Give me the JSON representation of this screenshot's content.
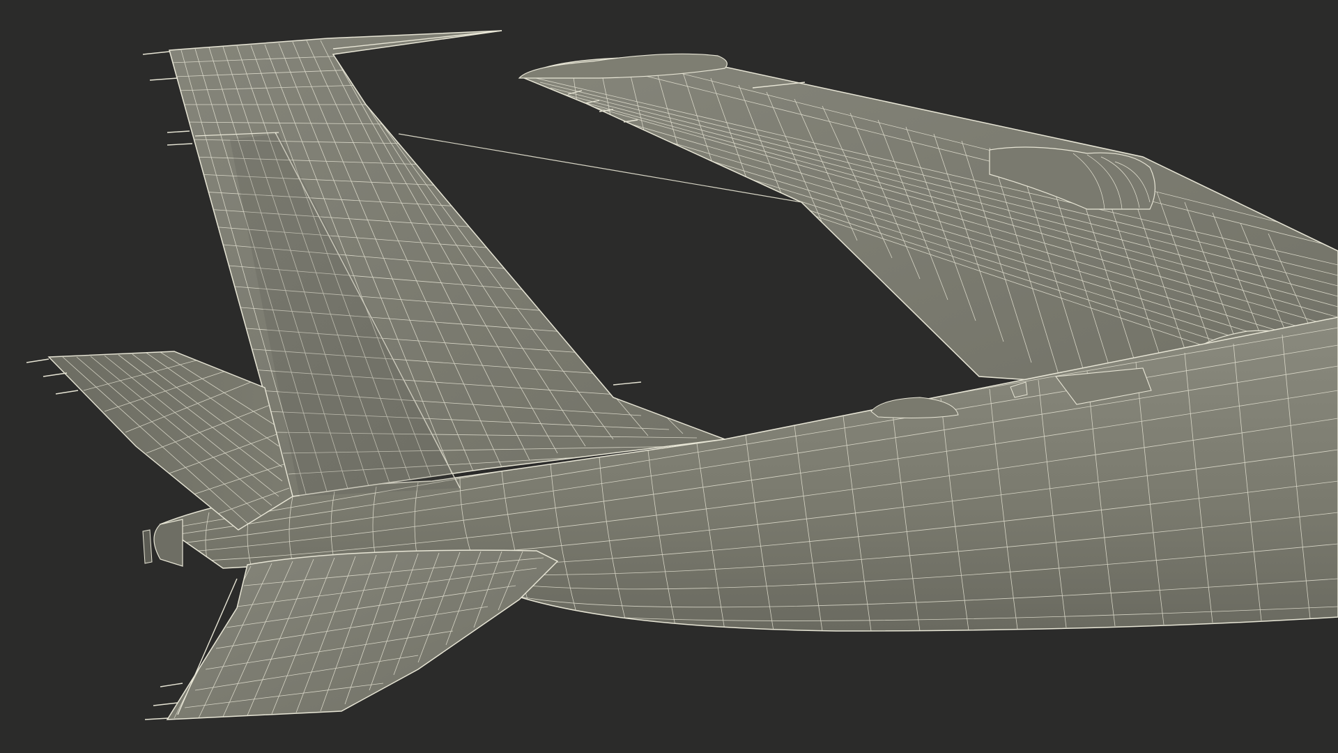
{
  "scene": {
    "subject": "wireframe-aircraft-tail-and-wings",
    "background_color": "#2b2b2a",
    "surface_color": "#7b7b6f",
    "wire_color": "#e8e6d6",
    "shadow_color": "#4e4e47"
  }
}
